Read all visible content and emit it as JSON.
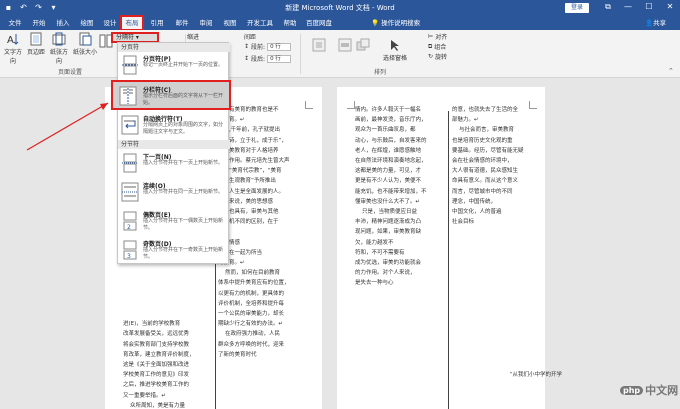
{
  "titlebar": {
    "title": "新建 Microsoft Word 文档 - Word",
    "login": "登录",
    "win_restore": "⧉",
    "win_min": "—",
    "win_max": "☐",
    "win_close": "✕"
  },
  "tabs": [
    "文件",
    "开始",
    "插入",
    "绘图",
    "设计",
    "布局",
    "引用",
    "邮件",
    "审阅",
    "视图",
    "开发工具",
    "帮助",
    "百度网盘"
  ],
  "tellme": "操作说明搜索",
  "share": "共享",
  "ribbon": {
    "text_dir": "文字方向",
    "margins": "页边距",
    "orientation": "纸张方向",
    "size": "纸张大小",
    "page_setup": "页面设置",
    "breaks_btn": "分隔符 ▾",
    "indent": "缩进",
    "spacing": "间距",
    "before_label": "段前:",
    "before_val": "0 行",
    "after_label": "段后:",
    "after_val": "0 行",
    "arrange": "排列",
    "wrap": "环绕文字",
    "select_pane": "选择窗格",
    "align": "对齐",
    "group": "组合",
    "rotate": "旋转"
  },
  "dropdown": {
    "section_page": "分页符",
    "section_section": "分节符",
    "items": [
      {
        "title": "分页符(P)",
        "desc": "标记一页终止并开始下一页的位置。"
      },
      {
        "title": "分栏符(C)",
        "desc": "指示分栏符后面的文字将从下一栏开始。"
      },
      {
        "title": "自动换行符(T)",
        "desc": "分隔网页上的对象周围的文字，如分隔题注文字与正文。"
      },
      {
        "title": "下一页(N)",
        "desc": "插入分节符并在下一页上开始新节。"
      },
      {
        "title": "连续(O)",
        "desc": "插入分节符并在同一页上开始新节。"
      },
      {
        "title": "偶数页(E)",
        "desc": "插入分节符并在下一偶数页上开始新节。"
      },
      {
        "title": "奇数页(D)",
        "desc": "插入分节符并在下一奇数页上开始新节。"
      }
    ]
  },
  "doc": {
    "left_col1": "\n\n\n\n\n\n\n\n\n\n\n\n\n\n\n\n\n\n\n\n\n进(E)，当前的学校教育\n改革发展备受关，远远优秀\n将会实教育部门支持学校教\n育改革，建立教育评价制度，\n这是《关于全面加强和改进\n学校美育工作的意见》印发\n之后，推进学校美育工作的\n又一重要举措。↵\n    众所周知，美是有力量",
    "left_col2": "，设有美育的教育也是不\n的教育。↵\n    几千年前，孔子就提出\n兴于诗，立于礼，成于乐”，\n调审美教育对于人格培养\n重要作用。蔡元培先生曾大声\n呼，“美育代宗教”，“美育\n之人生观教育”予所推出\n美的人生是全面发展的人。\n一般来说，美的思想感\n同时也具有，审美与其他\n计算机不同的区别，在于\n语言\n想与情感\n结合在一起为所当\n为教育。↵\n    然而，如何在目前教育\n体系中提升美育应有的位置，\n以更有力的机制，更具体的\n评价机制，全培养和提升每\n一个公民的审美能力，却长\n期缺少行之有效的办法。↵\n    在政府强力推动，人民\n群众多方呼唤的时代，迎来\n了新的美育时代",
    "right_col1": "情内。许多人毅灭于一幅名\n画前，最神发烫，音乐厅内，\n观众为一首乐曲叹息，都\n动心，与乐鼓后，自发客来的\n老人，在辉煌，谁愿感触地\n在自然法环境和演奏地念起，\n这都是美的力量，可见，才\n更是有不少人认为，美便不\n能充饥，也不能带来增加，不\n懂审美也没什么大不了。↵\n    只是，当物质便应日益\n丰沛，精神问题逐渐成为凸\n现问题，如果，审美教育缺\n欠，能力越发不\n符和，不可不需要有\n成为优选，审美的功能就会\n的力作用。对个人来说，\n是失去一种与心",
    "right_col2": "的意，也就失去了生活的全\n部魅力。↵\n    与社会而言，审美教育\n也是培育历史文化观的重\n要基础。经历，尽管有能无疑\n会在社会情感的环境中，\n大人很有道德，民众感知生\n命具有意义。而从这个意义\n而言，尽管城市中的不同\n理念，中国传统，\n中国文化，人的普遍\n社会目标\n\n\n\n\n\n\n\n\n\n\n\n\n\n\n                                 “从我们小中学的开学"
  },
  "watermark": "中文网",
  "watermark_badge": "php"
}
